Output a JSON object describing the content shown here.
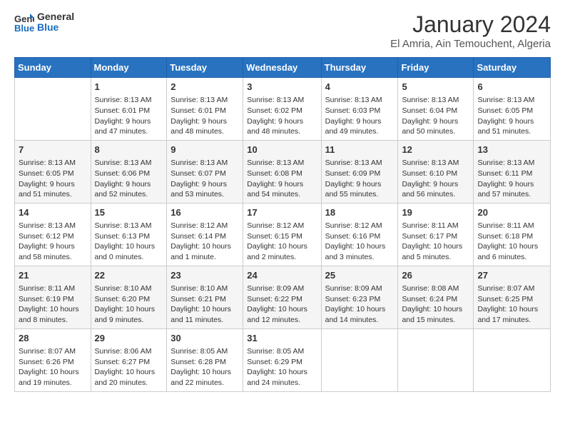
{
  "header": {
    "logo_line1": "General",
    "logo_line2": "Blue",
    "title": "January 2024",
    "subtitle": "El Amria, Ain Temouchent, Algeria"
  },
  "weekdays": [
    "Sunday",
    "Monday",
    "Tuesday",
    "Wednesday",
    "Thursday",
    "Friday",
    "Saturday"
  ],
  "weeks": [
    [
      {
        "day": "",
        "sunrise": "",
        "sunset": "",
        "daylight": ""
      },
      {
        "day": "1",
        "sunrise": "Sunrise: 8:13 AM",
        "sunset": "Sunset: 6:01 PM",
        "daylight": "Daylight: 9 hours and 47 minutes."
      },
      {
        "day": "2",
        "sunrise": "Sunrise: 8:13 AM",
        "sunset": "Sunset: 6:01 PM",
        "daylight": "Daylight: 9 hours and 48 minutes."
      },
      {
        "day": "3",
        "sunrise": "Sunrise: 8:13 AM",
        "sunset": "Sunset: 6:02 PM",
        "daylight": "Daylight: 9 hours and 48 minutes."
      },
      {
        "day": "4",
        "sunrise": "Sunrise: 8:13 AM",
        "sunset": "Sunset: 6:03 PM",
        "daylight": "Daylight: 9 hours and 49 minutes."
      },
      {
        "day": "5",
        "sunrise": "Sunrise: 8:13 AM",
        "sunset": "Sunset: 6:04 PM",
        "daylight": "Daylight: 9 hours and 50 minutes."
      },
      {
        "day": "6",
        "sunrise": "Sunrise: 8:13 AM",
        "sunset": "Sunset: 6:05 PM",
        "daylight": "Daylight: 9 hours and 51 minutes."
      }
    ],
    [
      {
        "day": "7",
        "sunrise": "Sunrise: 8:13 AM",
        "sunset": "Sunset: 6:05 PM",
        "daylight": "Daylight: 9 hours and 51 minutes."
      },
      {
        "day": "8",
        "sunrise": "Sunrise: 8:13 AM",
        "sunset": "Sunset: 6:06 PM",
        "daylight": "Daylight: 9 hours and 52 minutes."
      },
      {
        "day": "9",
        "sunrise": "Sunrise: 8:13 AM",
        "sunset": "Sunset: 6:07 PM",
        "daylight": "Daylight: 9 hours and 53 minutes."
      },
      {
        "day": "10",
        "sunrise": "Sunrise: 8:13 AM",
        "sunset": "Sunset: 6:08 PM",
        "daylight": "Daylight: 9 hours and 54 minutes."
      },
      {
        "day": "11",
        "sunrise": "Sunrise: 8:13 AM",
        "sunset": "Sunset: 6:09 PM",
        "daylight": "Daylight: 9 hours and 55 minutes."
      },
      {
        "day": "12",
        "sunrise": "Sunrise: 8:13 AM",
        "sunset": "Sunset: 6:10 PM",
        "daylight": "Daylight: 9 hours and 56 minutes."
      },
      {
        "day": "13",
        "sunrise": "Sunrise: 8:13 AM",
        "sunset": "Sunset: 6:11 PM",
        "daylight": "Daylight: 9 hours and 57 minutes."
      }
    ],
    [
      {
        "day": "14",
        "sunrise": "Sunrise: 8:13 AM",
        "sunset": "Sunset: 6:12 PM",
        "daylight": "Daylight: 9 hours and 58 minutes."
      },
      {
        "day": "15",
        "sunrise": "Sunrise: 8:13 AM",
        "sunset": "Sunset: 6:13 PM",
        "daylight": "Daylight: 10 hours and 0 minutes."
      },
      {
        "day": "16",
        "sunrise": "Sunrise: 8:12 AM",
        "sunset": "Sunset: 6:14 PM",
        "daylight": "Daylight: 10 hours and 1 minute."
      },
      {
        "day": "17",
        "sunrise": "Sunrise: 8:12 AM",
        "sunset": "Sunset: 6:15 PM",
        "daylight": "Daylight: 10 hours and 2 minutes."
      },
      {
        "day": "18",
        "sunrise": "Sunrise: 8:12 AM",
        "sunset": "Sunset: 6:16 PM",
        "daylight": "Daylight: 10 hours and 3 minutes."
      },
      {
        "day": "19",
        "sunrise": "Sunrise: 8:11 AM",
        "sunset": "Sunset: 6:17 PM",
        "daylight": "Daylight: 10 hours and 5 minutes."
      },
      {
        "day": "20",
        "sunrise": "Sunrise: 8:11 AM",
        "sunset": "Sunset: 6:18 PM",
        "daylight": "Daylight: 10 hours and 6 minutes."
      }
    ],
    [
      {
        "day": "21",
        "sunrise": "Sunrise: 8:11 AM",
        "sunset": "Sunset: 6:19 PM",
        "daylight": "Daylight: 10 hours and 8 minutes."
      },
      {
        "day": "22",
        "sunrise": "Sunrise: 8:10 AM",
        "sunset": "Sunset: 6:20 PM",
        "daylight": "Daylight: 10 hours and 9 minutes."
      },
      {
        "day": "23",
        "sunrise": "Sunrise: 8:10 AM",
        "sunset": "Sunset: 6:21 PM",
        "daylight": "Daylight: 10 hours and 11 minutes."
      },
      {
        "day": "24",
        "sunrise": "Sunrise: 8:09 AM",
        "sunset": "Sunset: 6:22 PM",
        "daylight": "Daylight: 10 hours and 12 minutes."
      },
      {
        "day": "25",
        "sunrise": "Sunrise: 8:09 AM",
        "sunset": "Sunset: 6:23 PM",
        "daylight": "Daylight: 10 hours and 14 minutes."
      },
      {
        "day": "26",
        "sunrise": "Sunrise: 8:08 AM",
        "sunset": "Sunset: 6:24 PM",
        "daylight": "Daylight: 10 hours and 15 minutes."
      },
      {
        "day": "27",
        "sunrise": "Sunrise: 8:07 AM",
        "sunset": "Sunset: 6:25 PM",
        "daylight": "Daylight: 10 hours and 17 minutes."
      }
    ],
    [
      {
        "day": "28",
        "sunrise": "Sunrise: 8:07 AM",
        "sunset": "Sunset: 6:26 PM",
        "daylight": "Daylight: 10 hours and 19 minutes."
      },
      {
        "day": "29",
        "sunrise": "Sunrise: 8:06 AM",
        "sunset": "Sunset: 6:27 PM",
        "daylight": "Daylight: 10 hours and 20 minutes."
      },
      {
        "day": "30",
        "sunrise": "Sunrise: 8:05 AM",
        "sunset": "Sunset: 6:28 PM",
        "daylight": "Daylight: 10 hours and 22 minutes."
      },
      {
        "day": "31",
        "sunrise": "Sunrise: 8:05 AM",
        "sunset": "Sunset: 6:29 PM",
        "daylight": "Daylight: 10 hours and 24 minutes."
      },
      {
        "day": "",
        "sunrise": "",
        "sunset": "",
        "daylight": ""
      },
      {
        "day": "",
        "sunrise": "",
        "sunset": "",
        "daylight": ""
      },
      {
        "day": "",
        "sunrise": "",
        "sunset": "",
        "daylight": ""
      }
    ]
  ]
}
